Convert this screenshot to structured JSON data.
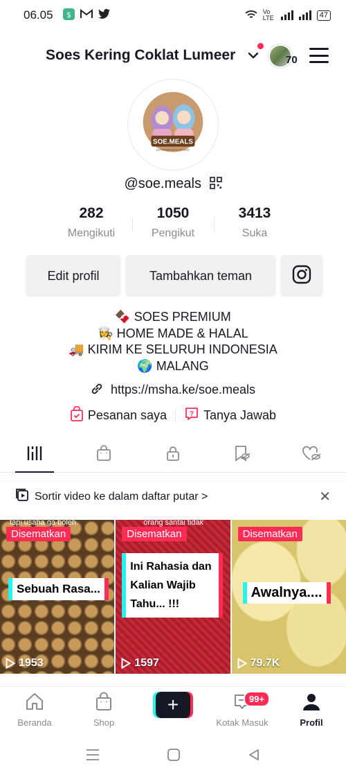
{
  "status_bar": {
    "time": "06.05",
    "network_label": "Vo LTE",
    "battery": "47"
  },
  "header": {
    "account_name": "Soes Kering Coklat Lumeer",
    "story_count": "70"
  },
  "profile": {
    "avatar_brand": "SOE.MEALS",
    "avatar_tagline": "EN MASAK SOLE STUDIO",
    "username": "@soe.meals",
    "stats": [
      {
        "value": "282",
        "label": "Mengikuti"
      },
      {
        "value": "1050",
        "label": "Pengikut"
      },
      {
        "value": "3413",
        "label": "Suka"
      }
    ],
    "edit_button": "Edit profil",
    "add_friends_button": "Tambahkan teman",
    "bio_lines": [
      "🍫 SOES PREMIUM",
      "👩‍🍳 HOME MADE & HALAL",
      "🚚 KIRIM KE SELURUH INDONESIA",
      "🌍 MALANG"
    ],
    "link": "https://msha.ke/soe.meals",
    "orders_label": "Pesanan saya",
    "qa_label": "Tanya Jawab"
  },
  "playlist_banner": {
    "text": "Sortir video ke dalam daftar putar >"
  },
  "videos": [
    {
      "pinned": "Disematkan",
      "caption": "Sebuah Rasa...",
      "views": "1953",
      "overlay_text": "tapi usaha ga boleh"
    },
    {
      "pinned": "Disematkan",
      "caption": "Ini Rahasia dan Kalian Wajib Tahu... !!!",
      "views": "1597",
      "overlay_text": "orang santai tidak sukses"
    },
    {
      "pinned": "Disematkan",
      "caption": "Awalnya....",
      "views": "79.7K"
    }
  ],
  "bottom_nav": {
    "home": "Beranda",
    "shop": "Shop",
    "inbox": "Kotak Masuk",
    "inbox_badge": "99+",
    "profile": "Profil"
  },
  "colors": {
    "accent_red": "#fe2c55",
    "accent_cyan": "#25f4ee",
    "text_dark": "#161823",
    "text_muted": "#8a8b91"
  }
}
